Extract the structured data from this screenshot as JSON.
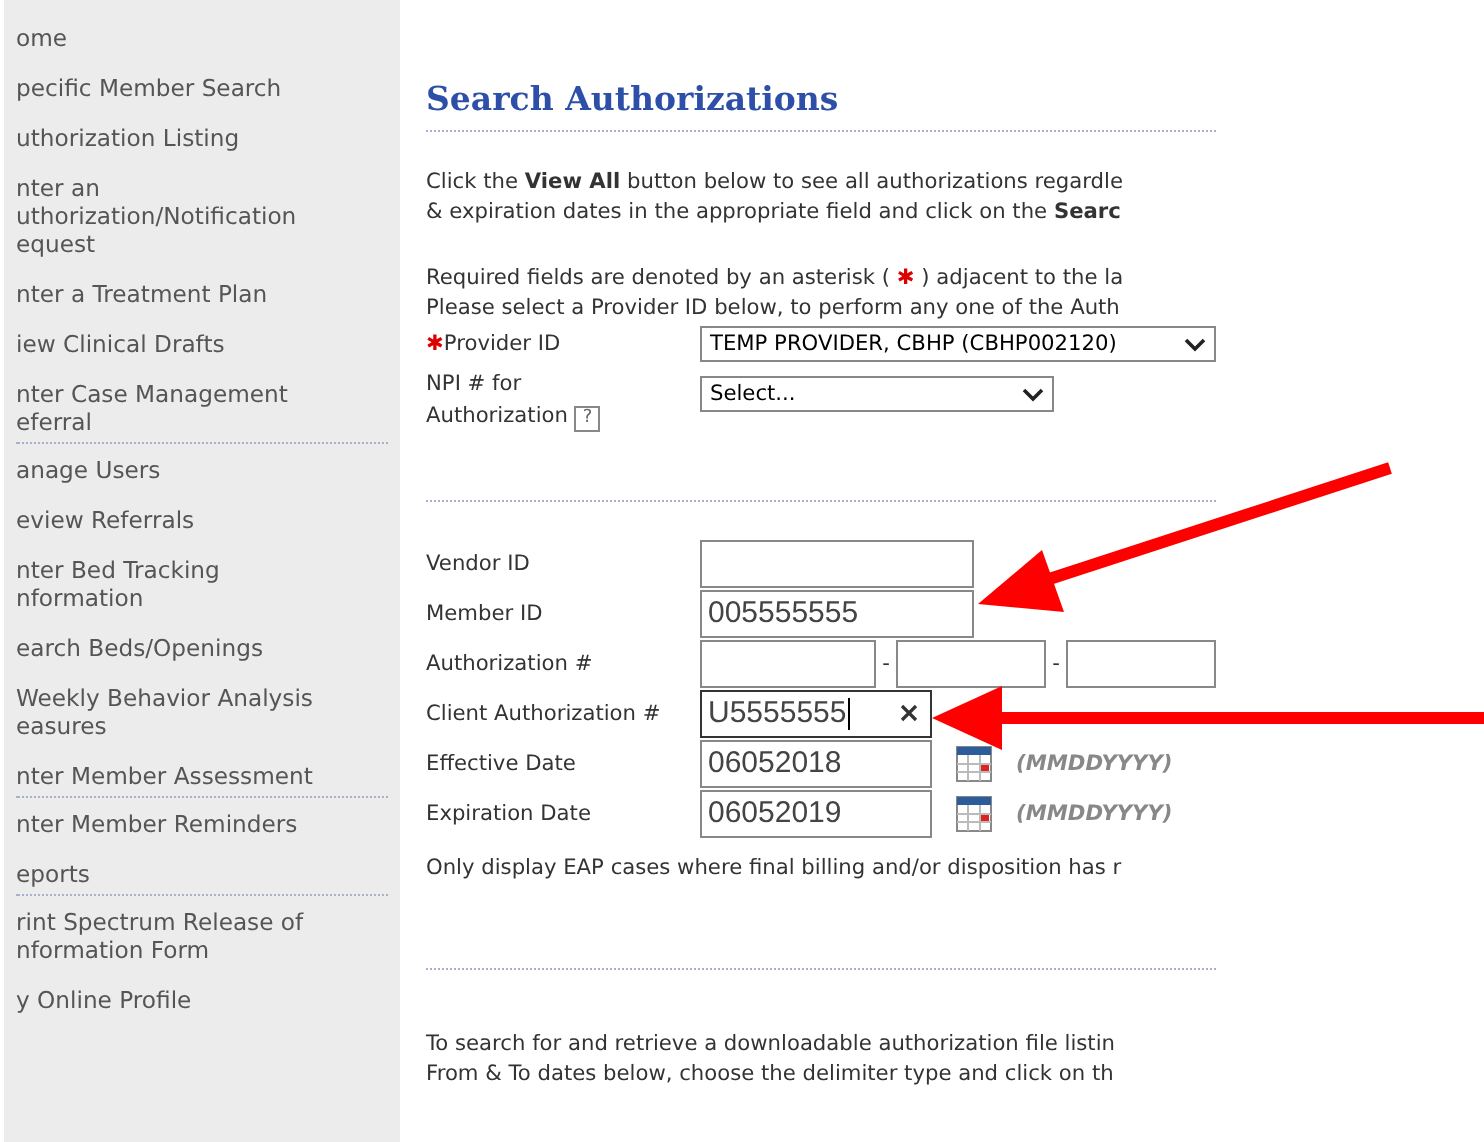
{
  "sidebar": {
    "items": [
      {
        "lines": [
          "ome"
        ],
        "divider_after": false
      },
      {
        "lines": [
          "pecific Member Search"
        ],
        "divider_after": false
      },
      {
        "lines": [
          "uthorization Listing"
        ],
        "divider_after": false
      },
      {
        "lines": [
          "nter an",
          "uthorization/Notification",
          "equest"
        ],
        "divider_after": false
      },
      {
        "lines": [
          "nter a Treatment Plan"
        ],
        "divider_after": false
      },
      {
        "lines": [
          "iew Clinical Drafts"
        ],
        "divider_after": false
      },
      {
        "lines": [
          "nter Case Management",
          "eferral"
        ],
        "divider_after": true
      },
      {
        "lines": [
          "anage Users"
        ],
        "divider_after": false
      },
      {
        "lines": [
          "eview Referrals"
        ],
        "divider_after": false
      },
      {
        "lines": [
          "nter Bed Tracking",
          "nformation"
        ],
        "divider_after": false
      },
      {
        "lines": [
          "earch Beds/Openings"
        ],
        "divider_after": false
      },
      {
        "lines": [
          "Weekly Behavior Analysis",
          "easures"
        ],
        "divider_after": false
      },
      {
        "lines": [
          "nter Member Assessment"
        ],
        "divider_after": true
      },
      {
        "lines": [
          "nter Member Reminders"
        ],
        "divider_after": false
      },
      {
        "lines": [
          "eports"
        ],
        "divider_after": true
      },
      {
        "lines": [
          "rint Spectrum Release of",
          "nformation Form"
        ],
        "divider_after": false
      },
      {
        "lines": [
          "y Online Profile"
        ],
        "divider_after": false
      }
    ]
  },
  "page": {
    "title": "Search Authorizations",
    "intro": [
      "Click the **View All** button below to see all authorizations regardle",
      "& expiration dates in the appropriate field and click on the **Searc**"
    ],
    "required_note": {
      "before": "Required fields are denoted by an asterisk (",
      "mark": "✱",
      "after": ") adjacent to the la"
    },
    "provider_note": "Please select a Provider ID below, to perform any one of the Auth",
    "provider": {
      "required_mark": "✱",
      "label": "Provider ID",
      "value": "TEMP PROVIDER, CBHP (CBHP002120)"
    },
    "npi": {
      "label_lines": [
        "NPI # for",
        "Authorization"
      ],
      "help": "?",
      "value": "Select..."
    },
    "fields": [
      {
        "kind": "text",
        "label": "Vendor ID"
      },
      {
        "kind": "text",
        "label": "Member ID",
        "value": "005555555"
      },
      {
        "kind": "split",
        "label": "Authorization #",
        "separators": [
          "-",
          "-"
        ]
      },
      {
        "kind": "clearable",
        "label": "Client Authorization #",
        "value": "U5555555",
        "focused": true
      },
      {
        "kind": "date",
        "label": "Effective Date",
        "value": "06052018",
        "format": "(MMDDYYYY)"
      },
      {
        "kind": "date",
        "label": "Expiration Date",
        "value": "06052019",
        "format": "(MMDDYYYY)"
      }
    ],
    "eap_note": "Only display EAP cases where final billing and/or disposition has r",
    "download_note": [
      "To search for and retrieve a downloadable authorization file listin",
      "From & To dates below, choose the delimiter type and click on th"
    ]
  }
}
